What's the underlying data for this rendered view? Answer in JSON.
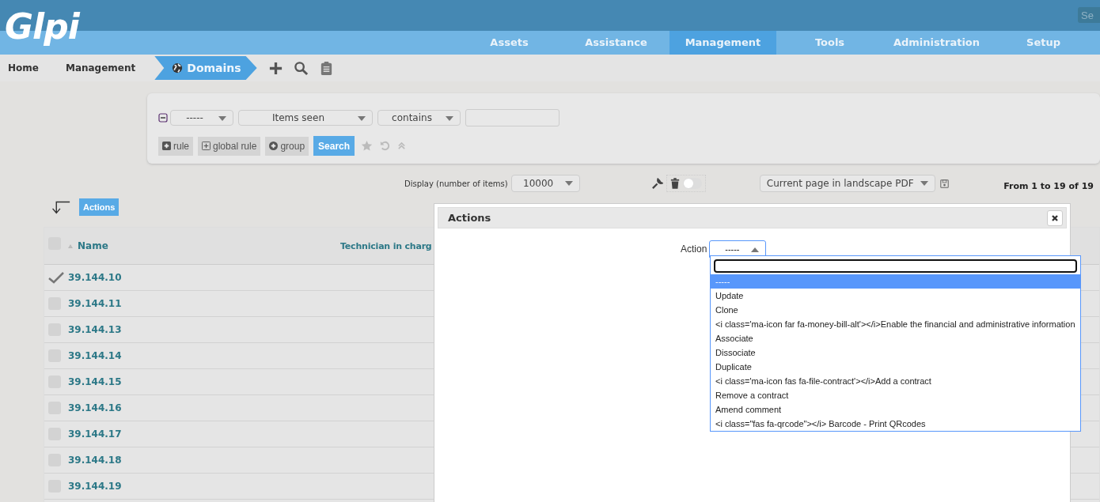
{
  "logo": "Glpi",
  "top_search": {
    "placeholder": "Se"
  },
  "menu": [
    {
      "label": "Assets",
      "selected": false
    },
    {
      "label": "Assistance",
      "selected": false
    },
    {
      "label": "Management",
      "selected": true
    },
    {
      "label": "Tools",
      "selected": false
    },
    {
      "label": "Administration",
      "selected": false
    },
    {
      "label": "Setup",
      "selected": false
    }
  ],
  "breadcrumb": [
    {
      "label": "Home",
      "selected": false
    },
    {
      "label": "Management",
      "selected": false
    },
    {
      "label": "Domains",
      "selected": true
    }
  ],
  "search_panel": {
    "criteria": [
      "-----",
      "Items seen",
      "contains"
    ],
    "add_buttons": [
      {
        "label": "rule",
        "kind": "plus-square"
      },
      {
        "label": "global rule",
        "kind": "plus-outline"
      },
      {
        "label": "group",
        "kind": "plus-circle"
      }
    ],
    "search_button": "Search"
  },
  "display": {
    "label": "Display (number of items)",
    "value": "10000",
    "toggle_on": false
  },
  "export": {
    "value": "Current page in landscape PDF"
  },
  "pagination": "From 1 to 19 of 19",
  "actions_button": "Actions",
  "table": {
    "select_all_checked": false,
    "columns": [
      "Name",
      "Technician in charg"
    ],
    "rows": [
      {
        "name": "39.144.10",
        "checked": true
      },
      {
        "name": "39.144.11",
        "checked": false
      },
      {
        "name": "39.144.13",
        "checked": false
      },
      {
        "name": "39.144.14",
        "checked": false
      },
      {
        "name": "39.144.15",
        "checked": false
      },
      {
        "name": "39.144.16",
        "checked": false
      },
      {
        "name": "39.144.17",
        "checked": false
      },
      {
        "name": "39.144.18",
        "checked": false
      },
      {
        "name": "39.144.19",
        "checked": false
      }
    ]
  },
  "dialog": {
    "title": "Actions",
    "action_label": "Action",
    "action_value": "-----",
    "options": [
      {
        "label": "-----",
        "selected": true
      },
      {
        "label": "Update",
        "selected": false
      },
      {
        "label": "Clone",
        "selected": false
      },
      {
        "label": "<i class='ma-icon far fa-money-bill-alt'></i>Enable the financial and administrative information",
        "selected": false
      },
      {
        "label": "Associate",
        "selected": false
      },
      {
        "label": "Dissociate",
        "selected": false
      },
      {
        "label": "Duplicate",
        "selected": false
      },
      {
        "label": "<i class='ma-icon fas fa-file-contract'></i>Add a contract",
        "selected": false
      },
      {
        "label": "Remove a contract",
        "selected": false
      },
      {
        "label": "Amend comment",
        "selected": false
      },
      {
        "label": "<i class=\"fas fa-qrcode\"></i> Barcode - Print QRcodes",
        "selected": false
      }
    ]
  }
}
